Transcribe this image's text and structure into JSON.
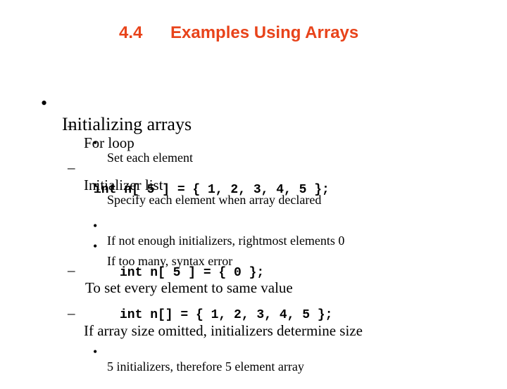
{
  "title": {
    "number": "4.4",
    "text": "Examples Using Arrays",
    "color": "#e8431a"
  },
  "bullets": {
    "main": "Initializing arrays",
    "for_loop": "For loop",
    "set_each": "Set each element",
    "initializer_list": "Initializer list",
    "specify_each": "Specify each element when array declared",
    "code1": "int n[ 5 ] = { 1, 2, 3, 4, 5 };",
    "not_enough": "If not enough initializers, rightmost elements 0",
    "too_many": "If too many, syntax error",
    "same_value": "To set every element to same value",
    "code2": "int n[ 5 ] = { 0 };",
    "size_omitted": "If array size omitted, initializers determine size",
    "code3": "int n[] = { 1, 2, 3, 4, 5 };",
    "five_init": "5 initializers, therefore 5 element array"
  },
  "markers": {
    "bullet": "•",
    "dash": "–"
  }
}
